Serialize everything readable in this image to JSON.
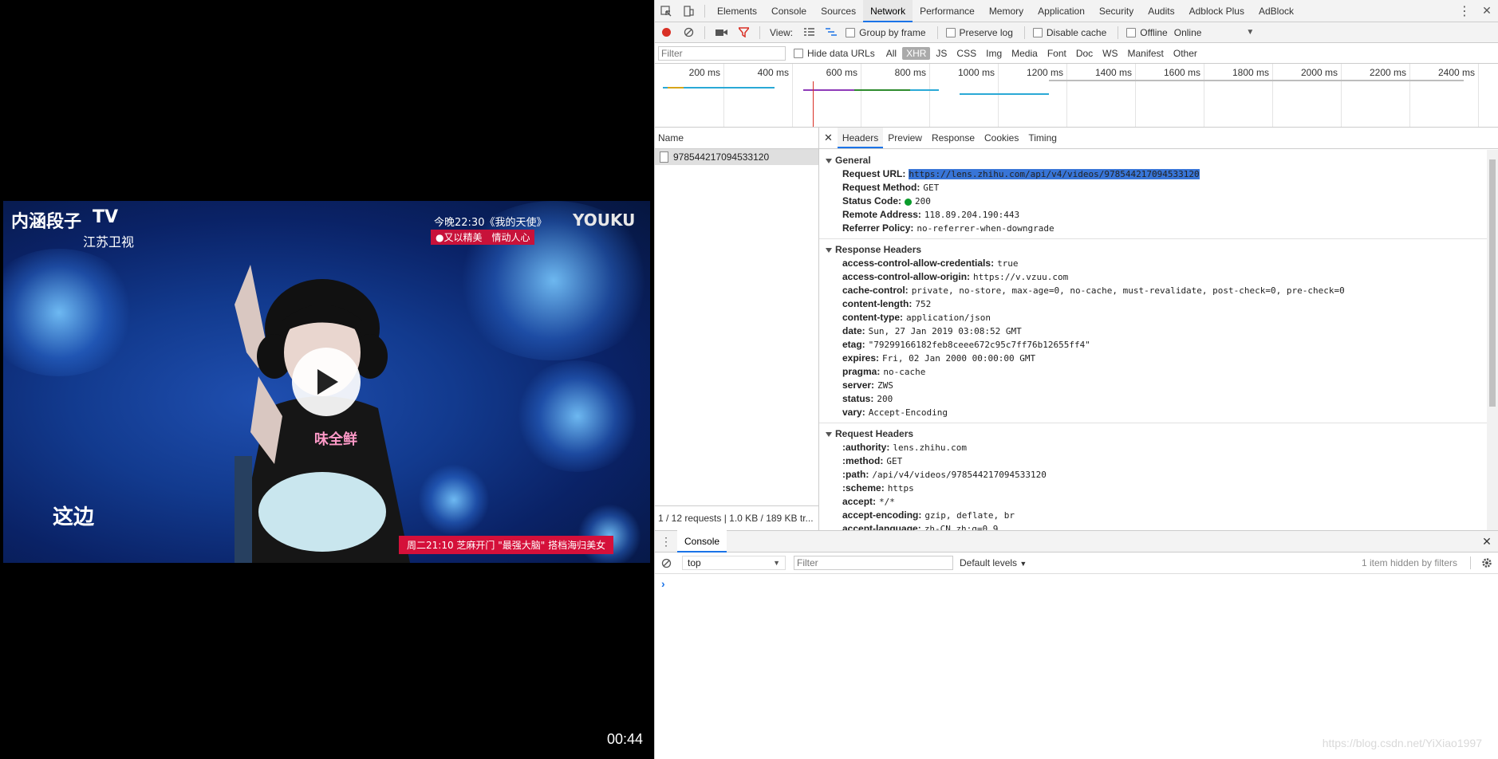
{
  "video": {
    "duration": "00:44",
    "overlay": {
      "logo_main": "内涵段子",
      "logo_tv": "TV",
      "channel": "江苏卫视",
      "youku": "YOUKU",
      "top_promo": "今晚22:30《我的天使》",
      "top_tag": "●又以精美　情动人心",
      "bottom_left": "这边",
      "bottom_banner": "周二21:10 芝麻开门 \"最强大脑\" 搭档海归美女",
      "shirt_text": "味全鲜"
    }
  },
  "devtools": {
    "tabs": [
      "Elements",
      "Console",
      "Sources",
      "Network",
      "Performance",
      "Memory",
      "Application",
      "Security",
      "Audits",
      "Adblock Plus",
      "AdBlock"
    ],
    "active_tab": "Network",
    "toolbar": {
      "view_label": "View:",
      "group_by_frame": "Group by frame",
      "preserve_log": "Preserve log",
      "disable_cache": "Disable cache",
      "offline": "Offline",
      "throttle": "Online"
    },
    "filter": {
      "placeholder": "Filter",
      "hide_data_urls": "Hide data URLs",
      "types": [
        "All",
        "XHR",
        "JS",
        "CSS",
        "Img",
        "Media",
        "Font",
        "Doc",
        "WS",
        "Manifest",
        "Other"
      ],
      "active_type": "XHR"
    },
    "timeline": {
      "ticks": [
        "200 ms",
        "400 ms",
        "600 ms",
        "800 ms",
        "1000 ms",
        "1200 ms",
        "1400 ms",
        "1600 ms",
        "1800 ms",
        "2000 ms",
        "2200 ms",
        "2400 ms"
      ]
    },
    "requests": {
      "header": "Name",
      "items": [
        "978544217094533120"
      ],
      "summary": "1 / 12 requests  |  1.0 KB / 189 KB tr..."
    },
    "detail_tabs": [
      "Headers",
      "Preview",
      "Response",
      "Cookies",
      "Timing"
    ],
    "active_detail_tab": "Headers",
    "general": {
      "title": "General",
      "request_url": "https://lens.zhihu.com/api/v4/videos/978544217094533120",
      "request_method": "GET",
      "status_code": "200",
      "remote_address": "118.89.204.190:443",
      "referrer_policy": "no-referrer-when-downgrade"
    },
    "response_headers": {
      "title": "Response Headers",
      "items": [
        {
          "k": "access-control-allow-credentials:",
          "v": "true"
        },
        {
          "k": "access-control-allow-origin:",
          "v": "https://v.vzuu.com"
        },
        {
          "k": "cache-control:",
          "v": "private, no-store, max-age=0, no-cache, must-revalidate, post-check=0, pre-check=0"
        },
        {
          "k": "content-length:",
          "v": "752"
        },
        {
          "k": "content-type:",
          "v": "application/json"
        },
        {
          "k": "date:",
          "v": "Sun, 27 Jan 2019 03:08:52 GMT"
        },
        {
          "k": "etag:",
          "v": "\"79299166182feb8ceee672c95c7ff76b12655ff4\""
        },
        {
          "k": "expires:",
          "v": "Fri, 02 Jan 2000 00:00:00 GMT"
        },
        {
          "k": "pragma:",
          "v": "no-cache"
        },
        {
          "k": "server:",
          "v": "ZWS"
        },
        {
          "k": "status:",
          "v": "200"
        },
        {
          "k": "vary:",
          "v": "Accept-Encoding"
        }
      ]
    },
    "request_headers": {
      "title": "Request Headers",
      "items": [
        {
          "k": ":authority:",
          "v": "lens.zhihu.com"
        },
        {
          "k": ":method:",
          "v": "GET"
        },
        {
          "k": ":path:",
          "v": "/api/v4/videos/978544217094533120"
        },
        {
          "k": ":scheme:",
          "v": "https"
        },
        {
          "k": "accept:",
          "v": "*/*"
        },
        {
          "k": "accept-encoding:",
          "v": "gzip, deflate, br"
        },
        {
          "k": "accept-language:",
          "v": "zh-CN,zh;q=0.9"
        }
      ]
    },
    "general_labels": {
      "request_url": "Request URL:",
      "request_method": "Request Method:",
      "status_code": "Status Code:",
      "remote_address": "Remote Address:",
      "referrer_policy": "Referrer Policy:"
    },
    "drawer": {
      "tab": "Console",
      "context": "top",
      "filter_placeholder": "Filter",
      "levels": "Default levels",
      "hidden": "1 item hidden by filters",
      "prompt": "›"
    }
  },
  "watermark": "https://blog.csdn.net/YiXiao1997",
  "colors": {
    "accent": "#1a73e8",
    "record": "#d93025",
    "status_ok": "#0a9c2b",
    "selection": "#3875d7"
  }
}
